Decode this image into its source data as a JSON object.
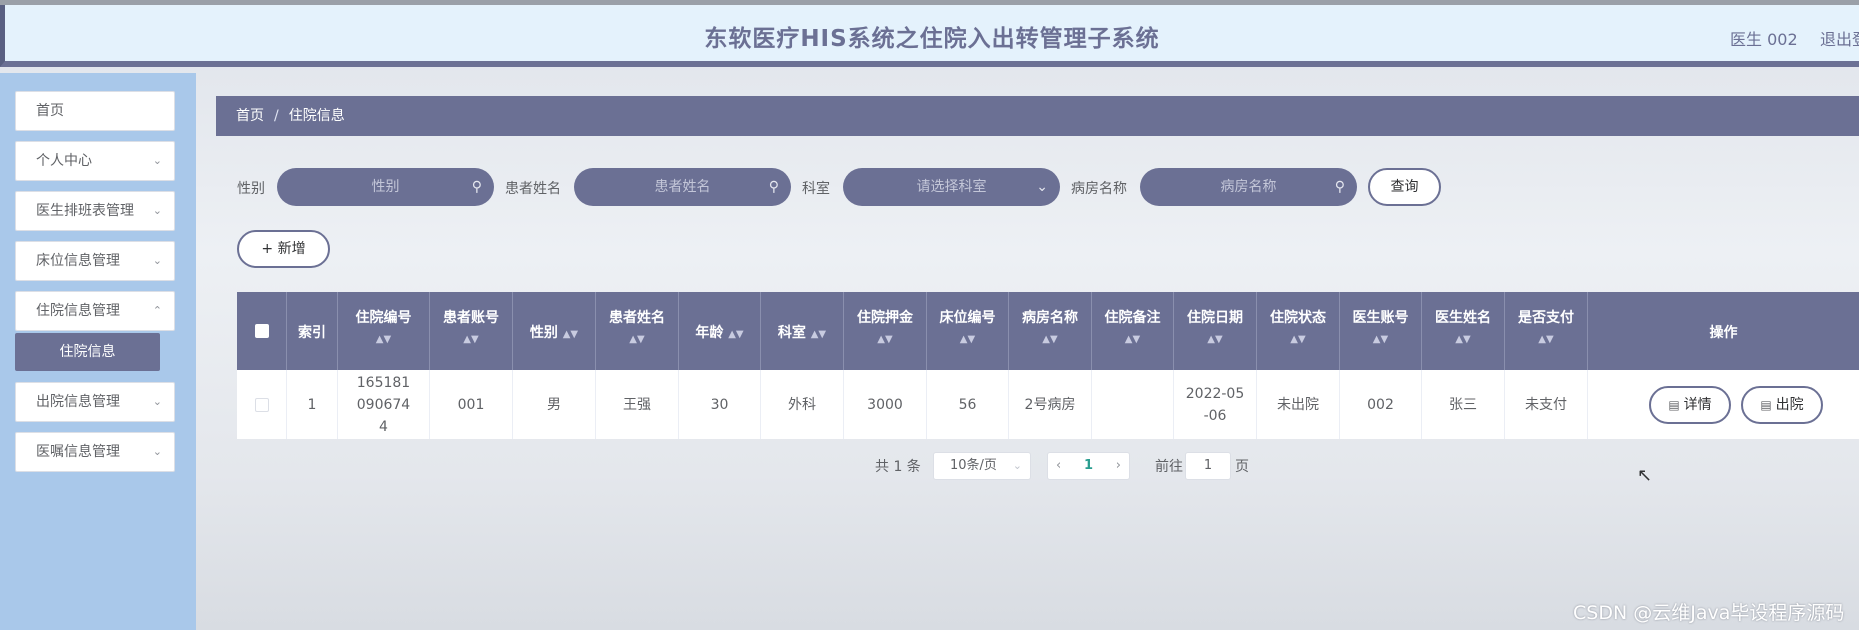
{
  "header": {
    "title": "东软医疗HIS系统之住院入出转管理子系统",
    "user": "医生 002",
    "logout": "退出登"
  },
  "sidebar": {
    "items": [
      {
        "label": "首页"
      },
      {
        "label": "个人中心"
      },
      {
        "label": "医生排班表管理"
      },
      {
        "label": "床位信息管理"
      },
      {
        "label": "住院信息管理"
      },
      {
        "label": "出院信息管理"
      },
      {
        "label": "医嘱信息管理"
      }
    ],
    "active_sub": "住院信息"
  },
  "breadcrumb": {
    "home": "首页",
    "sep": "/",
    "current": "住院信息"
  },
  "filters": {
    "gender_label": "性别",
    "gender_placeholder": "性别",
    "name_label": "患者姓名",
    "name_placeholder": "患者姓名",
    "dept_label": "科室",
    "dept_placeholder": "请选择科室",
    "ward_label": "病房名称",
    "ward_placeholder": "病房名称",
    "search_button": "查询"
  },
  "add_button": "+ 新增",
  "table": {
    "columns": [
      "索引",
      "住院编号",
      "患者账号",
      "性别",
      "患者姓名",
      "年龄",
      "科室",
      "住院押金",
      "床位编号",
      "病房名称",
      "住院备注",
      "住院日期",
      "住院状态",
      "医生账号",
      "医生姓名",
      "是否支付",
      "操作"
    ],
    "rows": [
      {
        "index": "1",
        "admission_no": "1651810906744",
        "patient_account": "001",
        "gender": "男",
        "patient_name": "王强",
        "age": "30",
        "department": "外科",
        "deposit": "3000",
        "bed_no": "56",
        "ward_name": "2号病房",
        "note": "",
        "admission_date": "2022-05-06",
        "status": "未出院",
        "doctor_account": "002",
        "doctor_name": "张三",
        "paid": "未支付",
        "detail_button": "详情",
        "discharge_button": "出院"
      }
    ]
  },
  "pagination": {
    "total": "共 1 条",
    "page_size": "10条/页",
    "current_page": "1",
    "goto_label": "前往",
    "goto_value": "1",
    "page_suffix": "页"
  },
  "watermark": "CSDN @云维Java毕设程序源码"
}
